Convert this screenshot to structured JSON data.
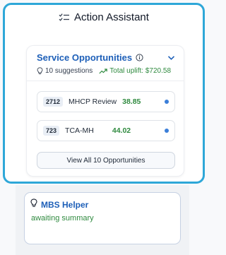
{
  "assistant": {
    "title": "Action Assistant",
    "icon": "checklist-icon",
    "highlight_color": "#2ea7d8"
  },
  "service_opportunities": {
    "title": "Service Opportunities",
    "suggestions_text": "10 suggestions",
    "uplift_text": "Total uplift: $720.58",
    "items": [
      {
        "code": "2712",
        "name": "MHCP Review",
        "value": "38.85"
      },
      {
        "code": "723",
        "name": "TCA-MH",
        "value": "44.02"
      }
    ],
    "view_all_label": "View All 10 Opportunities",
    "title_color": "#1d5fb8",
    "value_color": "#2f8a3f",
    "dot_color": "#3b7fd9"
  },
  "mbs_helper": {
    "title": "MBS Helper",
    "status": "awaiting summary",
    "icon": "lightbulb-icon"
  }
}
